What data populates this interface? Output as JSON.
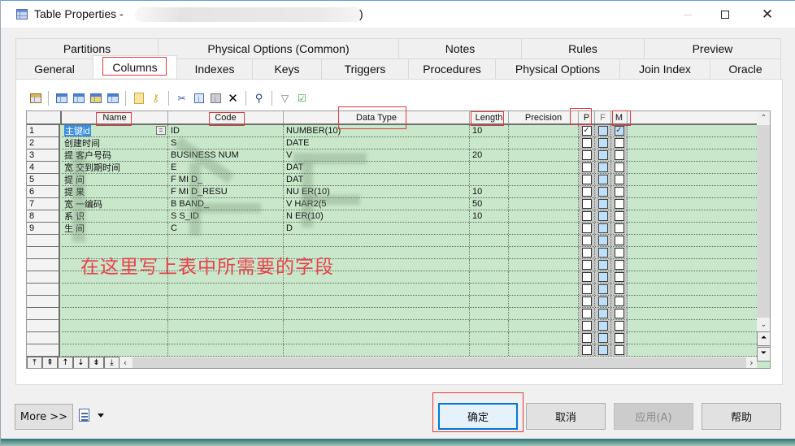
{
  "window": {
    "title": "Table Properties - ",
    "title_suffix": ")",
    "controls": {
      "minimize": "minimize",
      "maximize": "maximize",
      "close": "✕"
    }
  },
  "tabs": {
    "row1": [
      {
        "label": "Partitions"
      },
      {
        "label": "Physical Options (Common)"
      },
      {
        "label": "Notes"
      },
      {
        "label": "Rules"
      },
      {
        "label": "Preview"
      }
    ],
    "row2": [
      {
        "label": "General"
      },
      {
        "label": "Columns",
        "active": true
      },
      {
        "label": "Indexes"
      },
      {
        "label": "Keys"
      },
      {
        "label": "Triggers"
      },
      {
        "label": "Procedures"
      },
      {
        "label": "Physical Options"
      },
      {
        "label": "Join Index"
      },
      {
        "label": "Oracle"
      }
    ]
  },
  "toolbar": {
    "icons": [
      "properties-icon",
      "insert-row-icon",
      "add-row-icon",
      "add-columns-icon",
      "replicate-columns-icon",
      "clear-icon",
      "key-icon",
      "cut-icon",
      "copy-icon",
      "paste-icon",
      "delete-icon",
      "find-icon",
      "filter-icon",
      "customize-columns-icon"
    ]
  },
  "grid": {
    "headers": {
      "rownum": "",
      "name": "Name",
      "code": "Code",
      "data_type": "Data Type",
      "length": "Length",
      "precision": "Precision",
      "p": "P",
      "f": "F",
      "m": "M"
    },
    "rows": [
      {
        "num": "1",
        "name": "主键id",
        "code": "ID",
        "data_type": "NUMBER(10)",
        "length": "10",
        "precision": "",
        "p": true,
        "f": false,
        "m": true
      },
      {
        "num": "2",
        "name": "创建时间",
        "code": "S",
        "data_type": "DATE",
        "length": "",
        "precision": "",
        "p": false,
        "f": false,
        "m": false
      },
      {
        "num": "3",
        "name": "提 客户号码",
        "code": "BUSINESS NUM",
        "data_type": "V",
        "length": "20",
        "precision": "",
        "p": false,
        "f": false,
        "m": false
      },
      {
        "num": "4",
        "name": "宽 交到期时间",
        "code": "E",
        "data_type": "DAT",
        "length": "",
        "precision": "",
        "p": false,
        "f": false,
        "m": false
      },
      {
        "num": "5",
        "name": "提 间",
        "code": "F MI D_",
        "data_type": "DAT",
        "length": "",
        "precision": "",
        "p": false,
        "f": false,
        "m": false
      },
      {
        "num": "6",
        "name": "提 果",
        "code": "F MI D_RESU",
        "data_type": "NU ER(10)",
        "length": "10",
        "precision": "",
        "p": false,
        "f": false,
        "m": false
      },
      {
        "num": "7",
        "name": "宽 一编码",
        "code": "B BAND_",
        "data_type": "V HAR2(5",
        "length": "50",
        "precision": "",
        "p": false,
        "f": false,
        "m": false
      },
      {
        "num": "8",
        "name": "系 识",
        "code": "S S_ID",
        "data_type": "N ER(10)",
        "length": "10",
        "precision": "",
        "p": false,
        "f": false,
        "m": false
      },
      {
        "num": "9",
        "name": "生 间",
        "code": "C",
        "data_type": "D",
        "length": "",
        "precision": "",
        "p": false,
        "f": false,
        "m": false
      }
    ],
    "empty_rows": 11,
    "nav_buttons": [
      "move-top",
      "move-page-up",
      "move-up",
      "move-down",
      "move-page-down",
      "move-bottom"
    ],
    "nav_glyphs": [
      "⤒",
      "⇞",
      "↑",
      "↓",
      "⇟",
      "⤓"
    ]
  },
  "annotation": "在这里写上表中所需要的字段",
  "footer": {
    "more": "More >>",
    "ok": "确定",
    "cancel": "取消",
    "apply": "应用(A)",
    "help": "帮助"
  },
  "colors": {
    "grid_bg": "#c9e7cb",
    "selection": "#3b8ee0",
    "annotation": "#e8404a",
    "primary_border": "#0078d7"
  }
}
